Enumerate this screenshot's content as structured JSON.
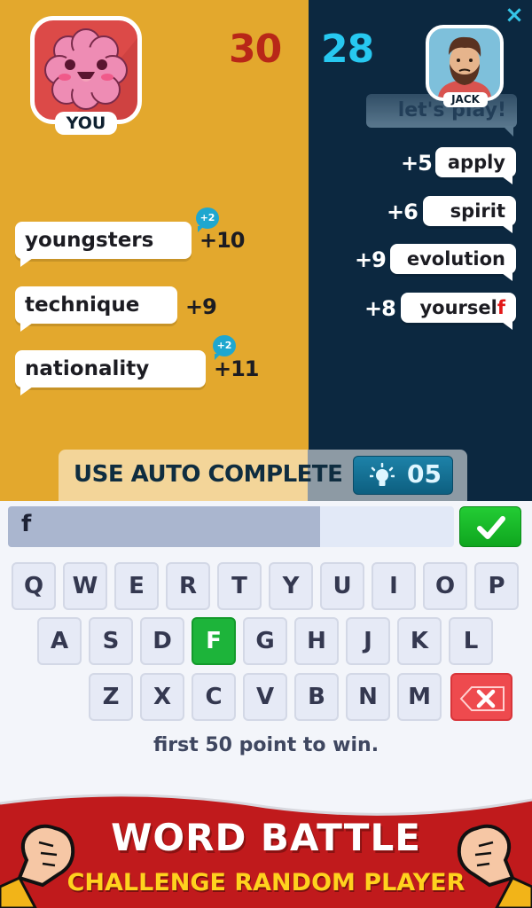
{
  "players": {
    "you": {
      "name": "YOU",
      "score": "30",
      "avatar": "brain-avatar"
    },
    "opponent": {
      "name": "JACK",
      "score": "28",
      "avatar": "bearded-man-avatar",
      "chat": "let's play!"
    }
  },
  "close_icon": "×",
  "your_words": [
    {
      "word": "youngsters",
      "points": "+10",
      "bonus": "+2"
    },
    {
      "word": "technique",
      "points": "+9",
      "bonus": null
    },
    {
      "word": "nationality",
      "points": "+11",
      "bonus": "+2"
    }
  ],
  "opponent_words": [
    {
      "word": "apply",
      "points": "+5"
    },
    {
      "word": "spirit",
      "points": "+6"
    },
    {
      "word": "evolution",
      "points": "+9"
    },
    {
      "word_prefix": "yoursel",
      "word_highlight": "f",
      "points": "+8"
    }
  ],
  "auto_complete": {
    "label": "USE AUTO COMPLETE",
    "count": "05",
    "icon": "lightbulb-icon"
  },
  "input": {
    "value": "f",
    "timer_progress": 0.7
  },
  "keyboard": {
    "rows": [
      [
        "Q",
        "W",
        "E",
        "R",
        "T",
        "Y",
        "U",
        "I",
        "O",
        "P"
      ],
      [
        "A",
        "S",
        "D",
        "F",
        "G",
        "H",
        "J",
        "K",
        "L"
      ],
      [
        "Z",
        "X",
        "C",
        "V",
        "B",
        "N",
        "M"
      ]
    ],
    "active_key": "F"
  },
  "hint": "first 50 point to win.",
  "banner": {
    "title": "WORD BATTLE",
    "subtitle": "CHALLENGE RANDOM PLAYER"
  },
  "colors": {
    "left_panel": "#e3a82d",
    "right_panel": "#0c2840",
    "your_score": "#b82718",
    "opponent_score": "#27c8f0",
    "active_key": "#1db43a",
    "backspace": "#ee4a4e",
    "banner": "#c01a1c"
  }
}
